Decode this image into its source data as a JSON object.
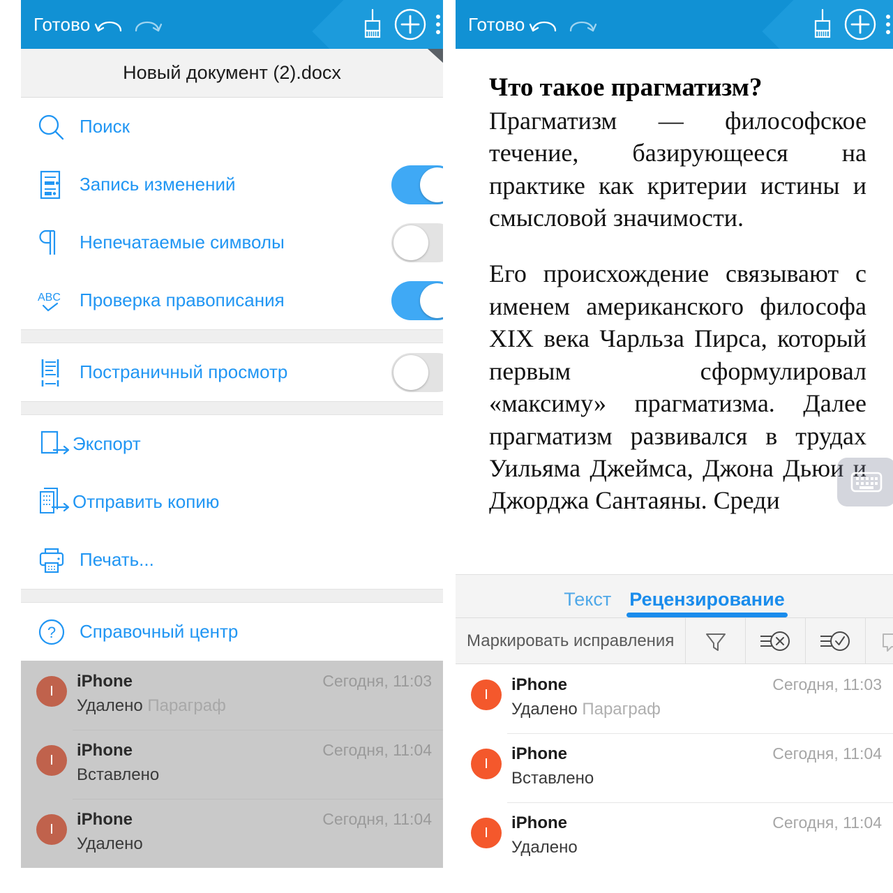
{
  "app": {
    "accent_blue": "#1191D4",
    "link_blue": "#2196F3",
    "avatar_orange": "#F4582C"
  },
  "topbar": {
    "done_label": "Готово",
    "undo_icon": "undo-icon",
    "redo_icon": "redo-icon",
    "brush_icon": "paintbrush-icon",
    "add_icon": "plus-circle-icon",
    "more_icon": "more-options-icon"
  },
  "left_panel": {
    "document_title": "Новый документ (2).docx",
    "menu_groups": [
      {
        "items": [
          {
            "icon": "search-icon",
            "label": "Поиск",
            "toggle": null
          },
          {
            "icon": "track-changes-icon",
            "label": "Запись изменений",
            "toggle": "on"
          },
          {
            "icon": "pilcrow-icon",
            "label": "Непечатаемые символы",
            "toggle": "off"
          },
          {
            "icon": "spellcheck-icon",
            "label": "Проверка правописания",
            "toggle": "on"
          }
        ]
      },
      {
        "items": [
          {
            "icon": "page-view-icon",
            "label": "Постраничный просмотр",
            "toggle": "off"
          }
        ]
      },
      {
        "items": [
          {
            "icon": "export-icon",
            "label": "Экспорт",
            "toggle": null
          },
          {
            "icon": "send-copy-icon",
            "label": "Отправить копию",
            "toggle": null
          },
          {
            "icon": "printer-icon",
            "label": "Печать...",
            "toggle": null
          }
        ]
      },
      {
        "items": [
          {
            "icon": "help-circle-icon",
            "label": "Справочный центр",
            "toggle": null
          }
        ]
      }
    ],
    "revisions": [
      {
        "author": "iPhone",
        "time": "Сегодня, 11:03",
        "action": "Удалено",
        "target": "Параграф",
        "avatar_initial": "I"
      },
      {
        "author": "iPhone",
        "time": "Сегодня, 11:04",
        "action": "Вставлено",
        "target": "",
        "avatar_initial": "I"
      },
      {
        "author": "iPhone",
        "time": "Сегодня, 11:04",
        "action": "Удалено",
        "target": "",
        "avatar_initial": "I"
      }
    ]
  },
  "right_panel": {
    "document": {
      "heading": "Что такое прагматизм?",
      "paragraph_1": "Прагматизм — философское течение, базирующееся на практике как критерии истины и смысловой значимости.",
      "paragraph_2": "Его происхождение связывают с именем американского философа XIX века Чарльза Пирса, который первым сформулировал «максиму» прагматизма. Далее прагматизм развивался в трудах Уильяма Джеймса, Джона Дьюи и Джорджа Сантаяны. Среди"
    },
    "keyboard_dismiss_icon": "keyboard-dismiss-icon",
    "tabs": [
      {
        "label": "Текст",
        "active": false
      },
      {
        "label": "Рецензирование",
        "active": true
      }
    ],
    "tools": {
      "mark_revisions_label": "Маркировать исправления",
      "filter_icon": "filter-icon",
      "reject_change_icon": "reject-change-icon",
      "accept_change_icon": "accept-change-icon",
      "comment_icon": "comment-icon"
    },
    "revisions": [
      {
        "author": "iPhone",
        "time": "Сегодня, 11:03",
        "action": "Удалено",
        "target": "Параграф",
        "avatar_initial": "I"
      },
      {
        "author": "iPhone",
        "time": "Сегодня, 11:04",
        "action": "Вставлено",
        "target": "",
        "avatar_initial": "I"
      },
      {
        "author": "iPhone",
        "time": "Сегодня, 11:04",
        "action": "Удалено",
        "target": "",
        "avatar_initial": "I"
      }
    ]
  }
}
